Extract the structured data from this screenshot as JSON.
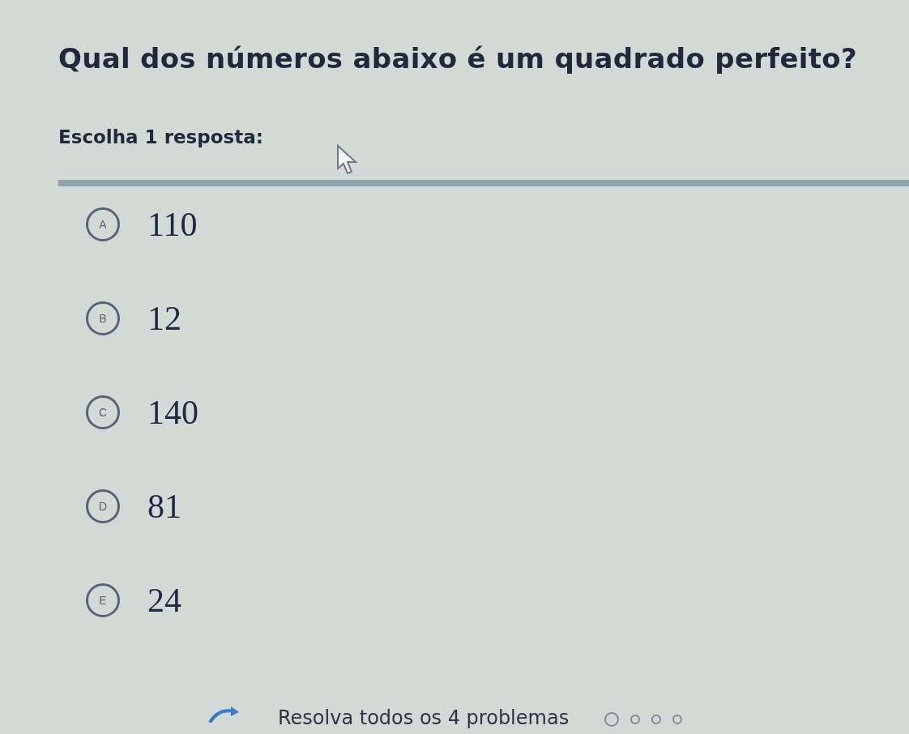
{
  "question": "Qual dos números abaixo é um quadrado perfeito?",
  "instruction": "Escolha 1 resposta:",
  "options": [
    {
      "letter": "A",
      "value": "110",
      "selected": false
    },
    {
      "letter": "B",
      "value": "12",
      "selected": false
    },
    {
      "letter": "C",
      "value": "140",
      "selected": false
    },
    {
      "letter": "D",
      "value": "81",
      "selected": false
    },
    {
      "letter": "E",
      "value": "24",
      "selected": false
    }
  ],
  "footer": {
    "text": "Resolva todos os 4 problemas",
    "dots": [
      {
        "selected": true
      },
      {
        "selected": false
      },
      {
        "selected": false
      },
      {
        "selected": false
      }
    ]
  }
}
